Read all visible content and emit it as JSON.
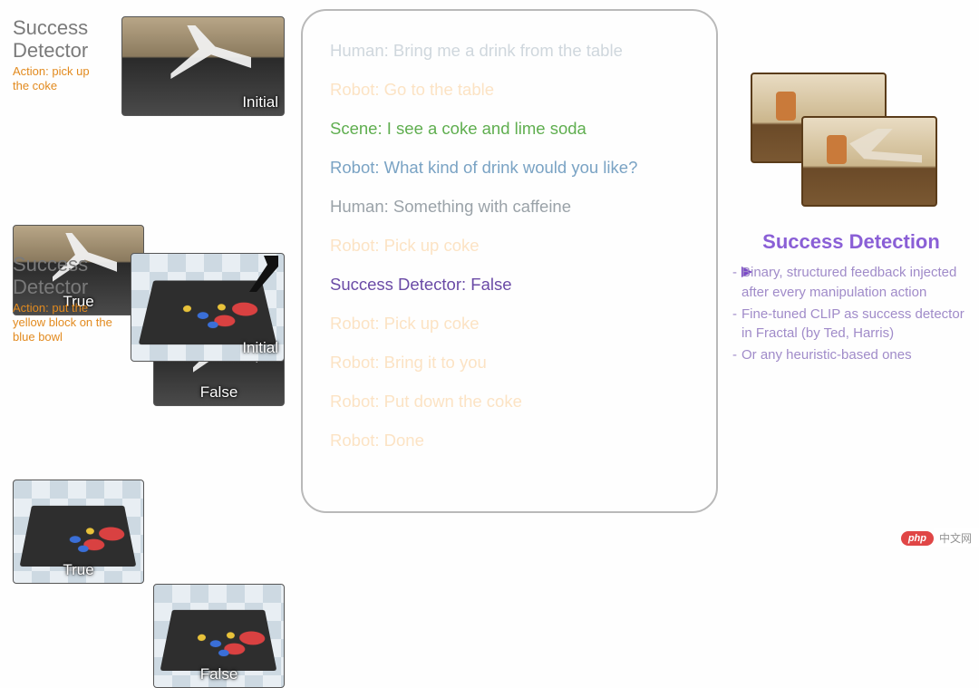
{
  "left_panels": [
    {
      "title": "Success\nDetector",
      "action_label": "Action: pick up the coke",
      "images": [
        {
          "label": "Initial",
          "kind": "lab"
        },
        {
          "label": "True",
          "kind": "lab"
        },
        {
          "label": "False",
          "kind": "lab"
        }
      ]
    },
    {
      "title": "Success\nDetector",
      "action_label": "Action: put the yellow block on the blue bowl",
      "images": [
        {
          "label": "Initial",
          "kind": "sim"
        },
        {
          "label": "True",
          "kind": "sim"
        },
        {
          "label": "False",
          "kind": "sim"
        }
      ]
    }
  ],
  "chat": [
    {
      "speaker": "Human",
      "text": "Bring me a drink from the table",
      "style": "c-human-f"
    },
    {
      "speaker": "Robot",
      "text": "Go to the table",
      "style": "c-robot-f"
    },
    {
      "speaker": "Scene",
      "text": "I see a coke and lime soda",
      "style": "c-scene"
    },
    {
      "speaker": "Robot",
      "text": "What kind of drink would you like?",
      "style": "c-robot-b"
    },
    {
      "speaker": "Human",
      "text": "Something with caffeine",
      "style": "c-human-b"
    },
    {
      "speaker": "Robot",
      "text": "Pick up coke",
      "style": "c-robot-f"
    },
    {
      "speaker": "Success Detector",
      "text": "False",
      "style": "c-hl"
    },
    {
      "speaker": "Robot",
      "text": "Pick up coke",
      "style": "c-robot-f"
    },
    {
      "speaker": "Robot",
      "text": "Bring it to you",
      "style": "c-robot-f"
    },
    {
      "speaker": "Robot",
      "text": "Put down the coke",
      "style": "c-robot-f"
    },
    {
      "speaker": "Robot",
      "text": "Done",
      "style": "c-robot-f"
    }
  ],
  "right": {
    "title": "Success Detection",
    "bullets": [
      "Binary, structured feedback injected after every manipulation action",
      "Fine-tuned CLIP as success detector in Fractal (by Ted, Harris)",
      "Or any heuristic-based ones"
    ]
  },
  "watermark": {
    "badge": "php",
    "text": "中文网"
  }
}
